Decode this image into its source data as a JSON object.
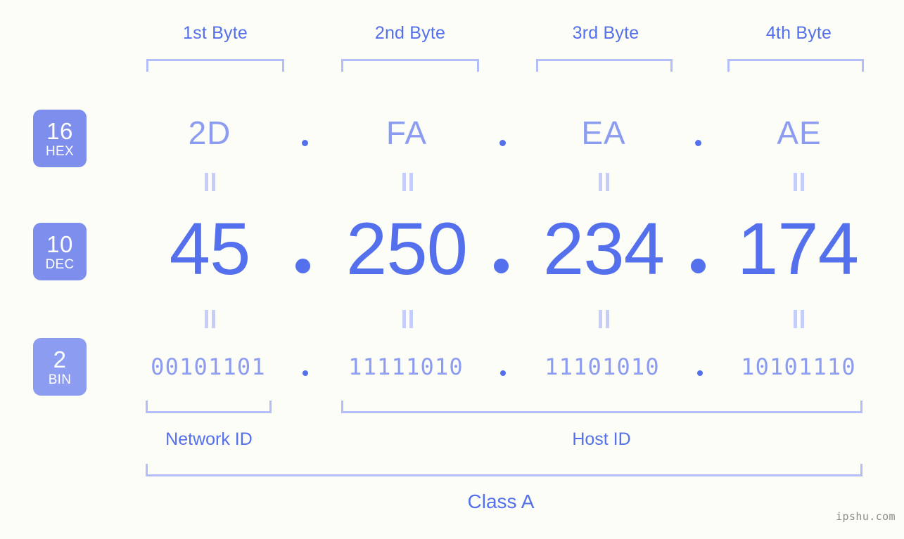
{
  "meta": {
    "watermark": "ipshu.com"
  },
  "byte_headers": [
    {
      "label": "1st Byte"
    },
    {
      "label": "2nd Byte"
    },
    {
      "label": "3rd Byte"
    },
    {
      "label": "4th Byte"
    }
  ],
  "rows": [
    {
      "key": "hex",
      "badge_number": "16",
      "badge_name": "HEX",
      "values": [
        "2D",
        "FA",
        "EA",
        "AE"
      ],
      "separator": "."
    },
    {
      "key": "dec",
      "badge_number": "10",
      "badge_name": "DEC",
      "values": [
        "45",
        "250",
        "234",
        "174"
      ],
      "separator": "."
    },
    {
      "key": "bin",
      "badge_number": "2",
      "badge_name": "BIN",
      "values": [
        "00101101",
        "11111010",
        "11101010",
        "10101110"
      ],
      "separator": "."
    }
  ],
  "equals_marker": "||",
  "sections": {
    "network_id": "Network ID",
    "host_id": "Host ID",
    "class": "Class A"
  },
  "colors": {
    "background": "#fcfdf7",
    "accent_strong": "#5470ec",
    "accent_mid": "#8c9cf0",
    "accent_light": "#b3bdf9",
    "badge_fill": "#7e8eed",
    "badge_text": "#ffffff",
    "watermark_text": "#8a8a8a"
  }
}
